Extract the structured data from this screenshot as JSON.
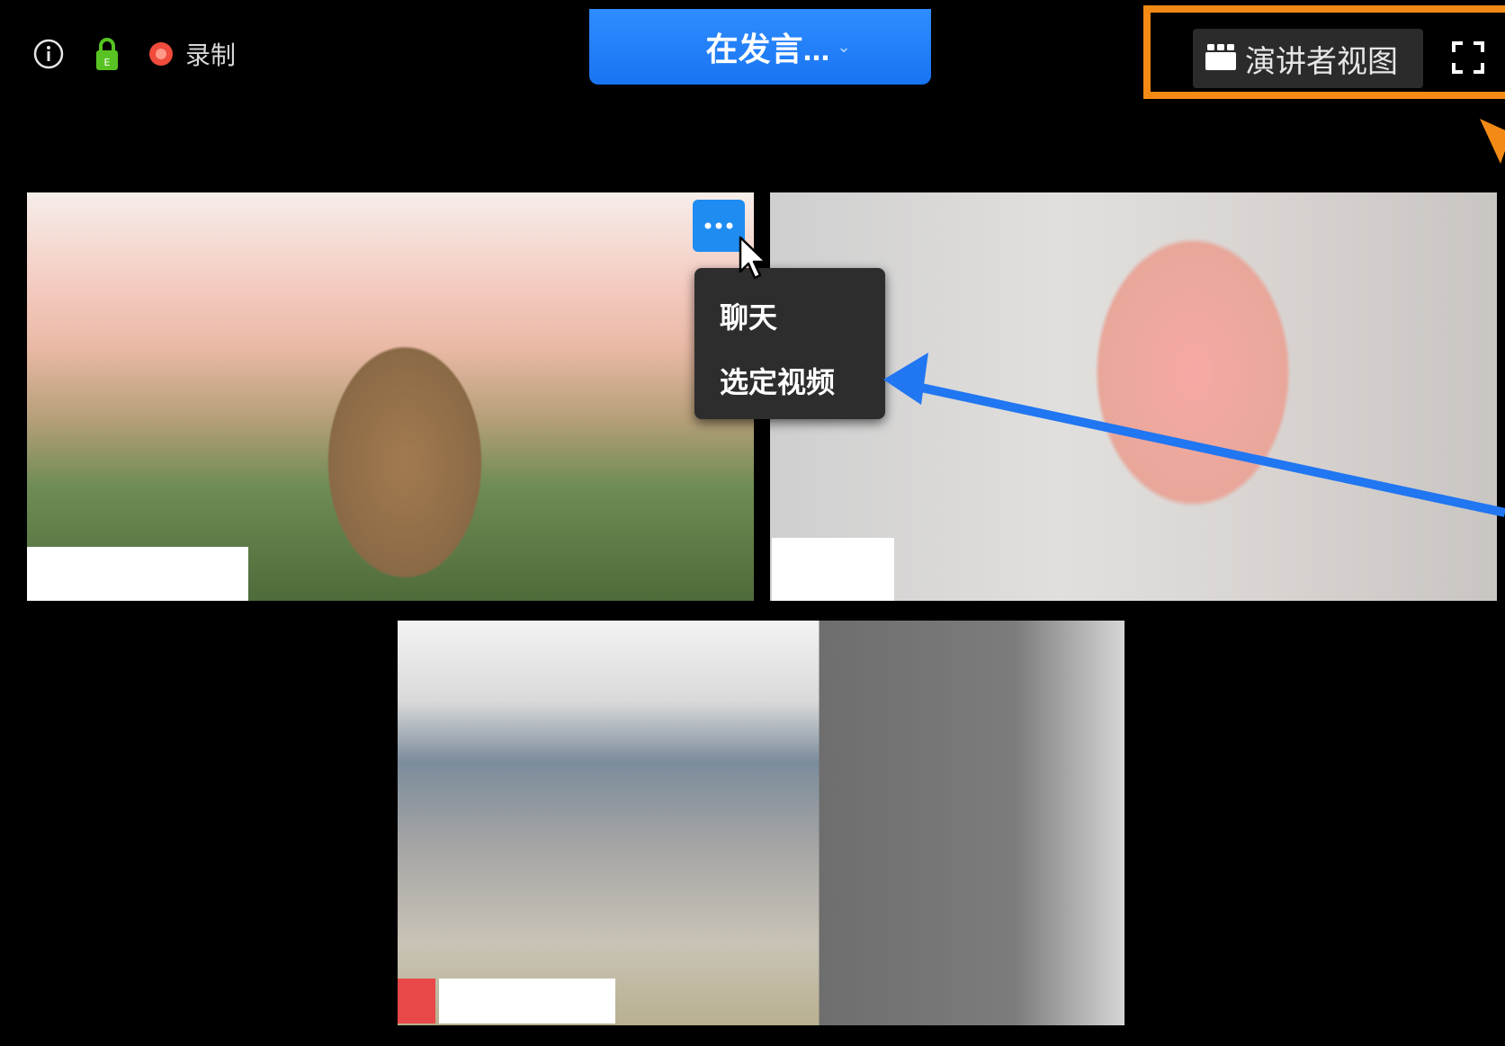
{
  "toolbar": {
    "recording_label": "录制"
  },
  "banner": {
    "talking_label": "在发言...",
    "caret": "⌄"
  },
  "top_right": {
    "view_label": "演讲者视图"
  },
  "context_menu": {
    "items": [
      "聊天",
      "选定视频"
    ]
  },
  "colors": {
    "accent_blue": "#1f8cf2",
    "annotation_orange": "#f28a15",
    "annotation_arrow_blue": "#2176f2",
    "lock_green": "#58c322",
    "record_red": "#f04b3c"
  },
  "icons": [
    "info-icon",
    "lock-icon",
    "record-icon",
    "gallery-icon",
    "fullscreen-icon",
    "more-icon",
    "cursor-icon"
  ]
}
